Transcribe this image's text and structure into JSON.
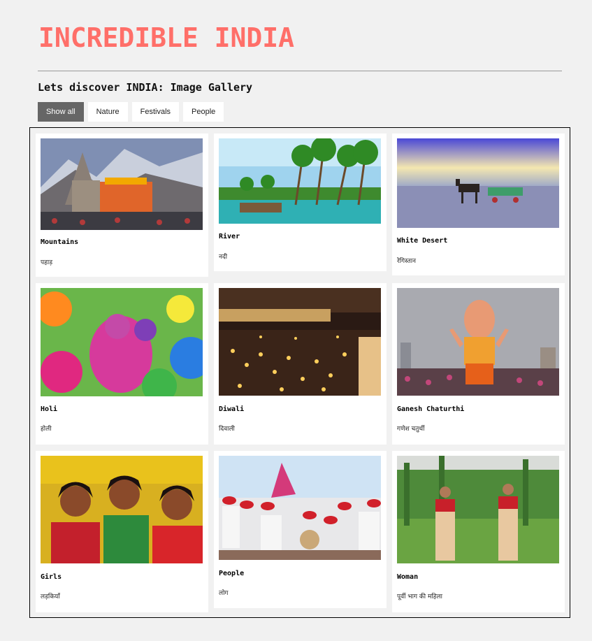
{
  "header": {
    "title": "INCREDIBLE INDIA",
    "subtitle": "Lets discover INDIA: Image Gallery"
  },
  "filters": [
    {
      "label": "Show all",
      "active": true
    },
    {
      "label": "Nature",
      "active": false
    },
    {
      "label": "Festivals",
      "active": false
    },
    {
      "label": "People",
      "active": false
    }
  ],
  "colors": {
    "accent": "#ff6f69",
    "background": "#f1f1f1",
    "active_filter": "#666666"
  },
  "gallery": [
    {
      "name": "Mountains",
      "desc": "पहाड़"
    },
    {
      "name": "River",
      "desc": "नदी"
    },
    {
      "name": "White Desert",
      "desc": "रेगिस्तान"
    },
    {
      "name": "Holi",
      "desc": "होली"
    },
    {
      "name": "Diwali",
      "desc": "दिवाली"
    },
    {
      "name": "Ganesh Chaturthi",
      "desc": "गणेश चतुर्थी"
    },
    {
      "name": "Girls",
      "desc": "लड़कियाँ"
    },
    {
      "name": "People",
      "desc": "लोग"
    },
    {
      "name": "Woman",
      "desc": "पूर्वी भाग की महिला"
    }
  ]
}
